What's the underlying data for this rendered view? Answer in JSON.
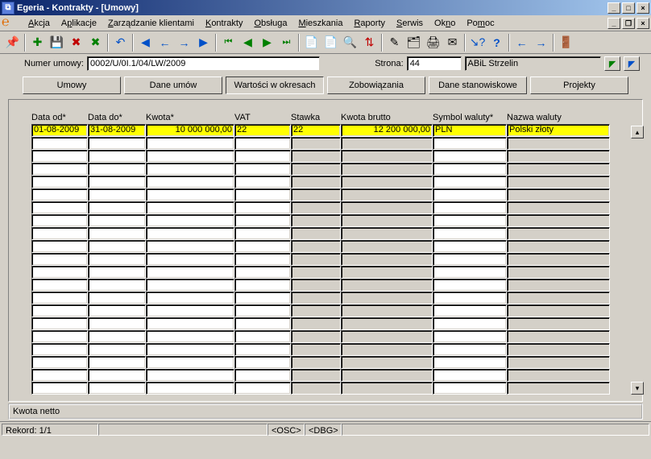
{
  "titlebar": {
    "text": "Egeria - Kontrakty - [Umowy]"
  },
  "menu": {
    "items": [
      "Akcja",
      "Aplikacje",
      "Zarządzanie klientami",
      "Kontrakty",
      "Obsługa",
      "Mieszkania",
      "Raporty",
      "Serwis",
      "Okno",
      "Pomoc"
    ]
  },
  "toolbar_icons": [
    "pin",
    "sep",
    "new",
    "save",
    "delete-red",
    "delete-green",
    "sep",
    "undo",
    "sep",
    "first",
    "prev",
    "next",
    "last",
    "sep",
    "rec-first",
    "rec-play-back",
    "rec-play",
    "rec-last",
    "sep",
    "search",
    "swap",
    "sep",
    "tree",
    "mail-open",
    "mail",
    "sep",
    "help-arrow",
    "help",
    "sep",
    "back",
    "forward",
    "sep",
    "door"
  ],
  "infobar": {
    "numer_label": "Numer umowy:",
    "numer_value": "0002/U/0I.1/04/LW/2009",
    "strona_label": "Strona:",
    "strona_value": "44",
    "strona_name": "ABiL Strzelin"
  },
  "tabs": [
    "Umowy",
    "Dane umów",
    "Wartości w okresach",
    "Zobowiązania",
    "Dane stanowiskowe",
    "Projekty"
  ],
  "active_tab": 2,
  "grid": {
    "headers": [
      "Data od*",
      "Data do*",
      "Kwota*",
      "VAT",
      "Stawka",
      "Kwota brutto",
      "Symbol waluty*",
      "Nazwa waluty"
    ],
    "row": {
      "data_od": "01-08-2009",
      "data_do": "31-08-2009",
      "kwota": "10 000 000,00",
      "vat": "22",
      "stawka": "22",
      "kwota_brutto": "12 200 000,00",
      "symbol": "PLN",
      "nazwa": "Polski złoty"
    },
    "empty_rows": 20
  },
  "status_frame_label": "Kwota netto",
  "statusbar": {
    "record": "Rekord: 1/1",
    "osc": "<OSC>",
    "dbg": "<DBG>"
  }
}
